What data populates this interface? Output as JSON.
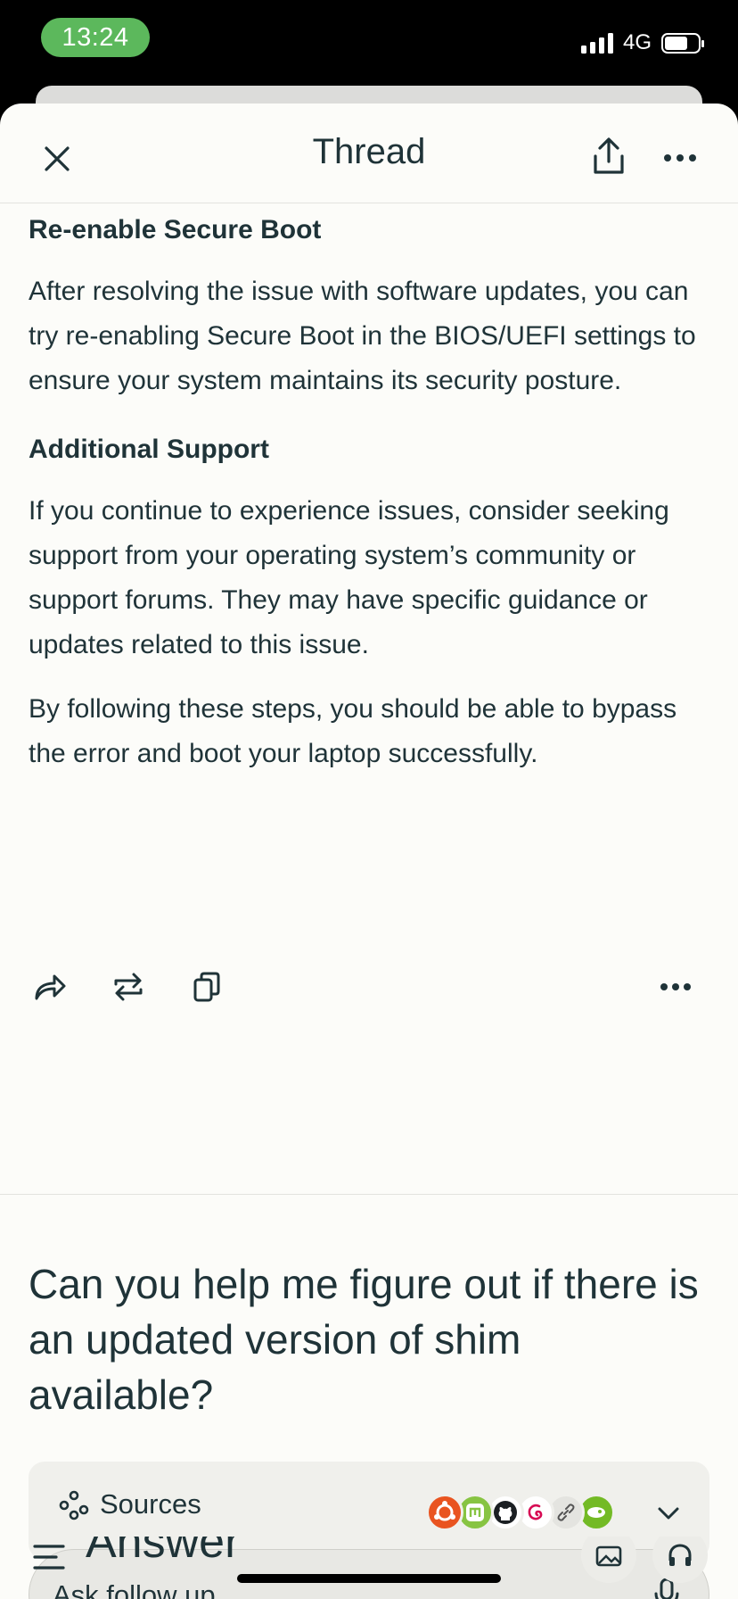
{
  "status_bar": {
    "time": "13:24",
    "network": "4G"
  },
  "header": {
    "title": "Thread"
  },
  "content": {
    "sections": [
      {
        "heading": "Re-enable Secure Boot",
        "paragraphs": [
          "After resolving the issue with software updates, you can try re-enabling Secure Boot in the BIOS/UEFI settings to ensure your system maintains its security posture."
        ]
      },
      {
        "heading": "Additional Support",
        "paragraphs": [
          "If you continue to experience issues, consider seeking support from your operating system’s community or support forums. They may have specific guidance or updates related to this issue.",
          "By following these steps, you should be able to bypass the error and boot your laptop successfully."
        ]
      }
    ]
  },
  "question": {
    "text": "Can you help me figure out if there is an updated version of shim available?"
  },
  "sources": {
    "label": "Sources",
    "favicons": [
      "ubuntu-icon",
      "linux-mint-icon",
      "github-icon",
      "debian-icon",
      "link-icon",
      "opensuse-icon"
    ]
  },
  "followup": {
    "placeholder": "Ask follow up..."
  },
  "answer": {
    "label": "Answer"
  },
  "colors": {
    "background": "#fcfcf9",
    "text": "#1f3338",
    "time_pill": "#5cb85c",
    "ubuntu": "#e95420",
    "mint": "#87c442",
    "debian": "#d70a53",
    "opensuse": "#73ba25"
  }
}
